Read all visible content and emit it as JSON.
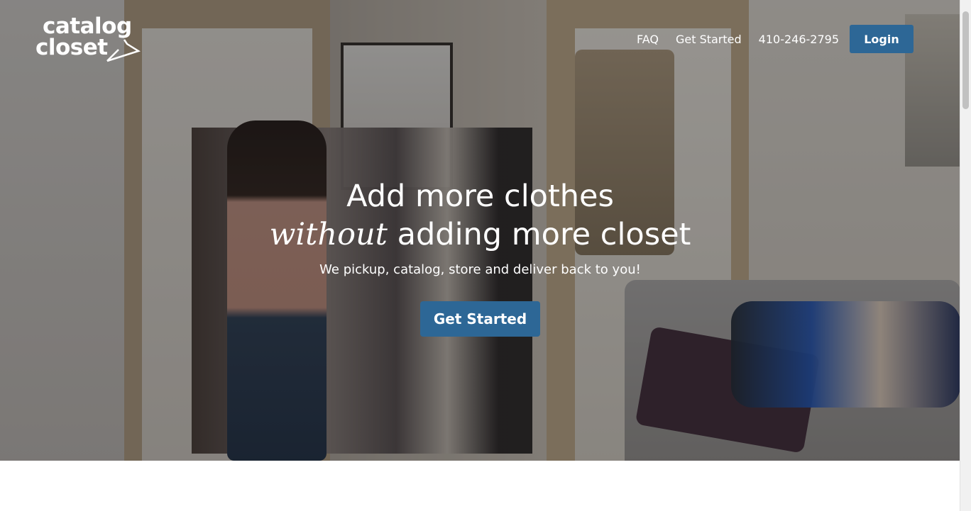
{
  "logo": {
    "line1": "catalog",
    "line2": "closet",
    "hanger_icon": "hanger-icon"
  },
  "nav": {
    "items": [
      {
        "label": "FAQ"
      },
      {
        "label": "Get Started"
      },
      {
        "label": "410-246-2795"
      }
    ],
    "login_label": "Login"
  },
  "hero": {
    "headline_line1": "Add more clothes",
    "headline_em": "without",
    "headline_rest": "adding more closet",
    "subtext": "We pickup, catalog, store and deliver back to you!",
    "cta_label": "Get Started"
  },
  "colors": {
    "primary_button": "#2d6796",
    "text_on_hero": "#ffffff"
  }
}
